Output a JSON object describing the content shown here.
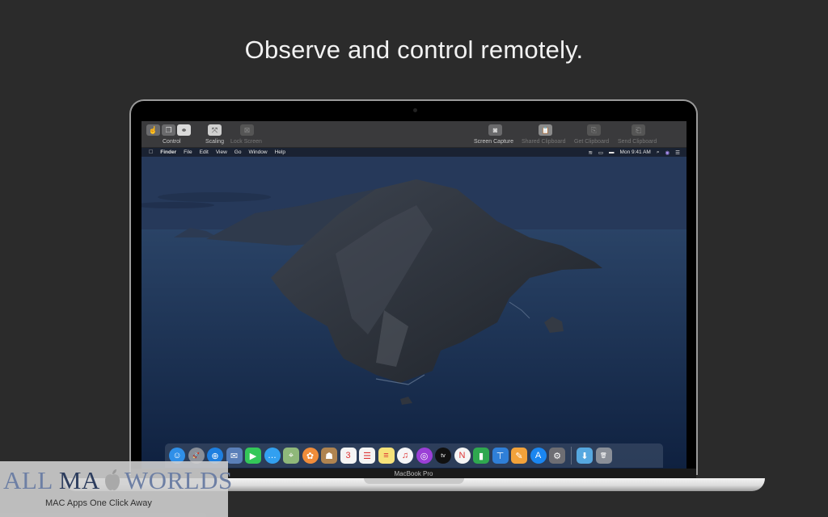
{
  "headline": "Observe and control remotely.",
  "device": {
    "model_label": "MacBook Pro"
  },
  "remote_toolbar": {
    "left_groups": [
      {
        "label": "Control",
        "buttons": [
          {
            "name": "pointer-control",
            "icon": "cursor-icon",
            "glyph": "☝",
            "state": "normal"
          },
          {
            "name": "window-control",
            "icon": "window-icon",
            "glyph": "❐",
            "state": "normal"
          },
          {
            "name": "observe",
            "icon": "binoculars-icon",
            "glyph": "⚭",
            "state": "active"
          }
        ]
      },
      {
        "label": "Scaling",
        "buttons": [
          {
            "name": "scaling",
            "icon": "scale-arrows-icon",
            "glyph": "⤧",
            "state": "normal"
          }
        ]
      },
      {
        "label": "Lock Screen",
        "buttons": [
          {
            "name": "lock-screen",
            "icon": "lock-screen-icon",
            "glyph": "⊠",
            "state": "disabled"
          }
        ]
      }
    ],
    "right_groups": [
      {
        "label": "Screen Capture",
        "icon": "camera-icon",
        "glyph": "◙",
        "state": "normal"
      },
      {
        "label": "Shared Clipboard",
        "icon": "shared-clipboard-icon",
        "glyph": "📋",
        "state": "disabled"
      },
      {
        "label": "Get Clipboard",
        "icon": "get-clipboard-icon",
        "glyph": "⎘",
        "state": "disabled"
      },
      {
        "label": "Send Clipboard",
        "icon": "send-clipboard-icon",
        "glyph": "⎗",
        "state": "disabled"
      }
    ]
  },
  "menubar": {
    "apple_glyph": "",
    "items": [
      "Finder",
      "File",
      "Edit",
      "View",
      "Go",
      "Window",
      "Help"
    ],
    "status": {
      "wifi_glyph": "≋",
      "airplay_glyph": "▭",
      "battery_glyph": "▬",
      "clock": "Mon 9:41 AM",
      "search_glyph": "⌕",
      "siri_glyph": "◉",
      "control_glyph": "☰"
    }
  },
  "dock": {
    "apps": [
      {
        "name": "Finder",
        "icon": "finder-icon",
        "glyph": "☺",
        "color": "#2f8fe8"
      },
      {
        "name": "Launchpad",
        "icon": "launchpad-icon",
        "glyph": "🚀",
        "color": "#8a8f98"
      },
      {
        "name": "Safari",
        "icon": "safari-icon",
        "glyph": "⊕",
        "color": "#1e7fe0"
      },
      {
        "name": "Mail",
        "icon": "mail-icon",
        "glyph": "✉",
        "color": "#5a7fb8"
      },
      {
        "name": "FaceTime",
        "icon": "facetime-icon",
        "glyph": "▶",
        "color": "#34c759"
      },
      {
        "name": "Messages",
        "icon": "messages-icon",
        "glyph": "…",
        "color": "#32a0f0"
      },
      {
        "name": "Maps",
        "icon": "maps-icon",
        "glyph": "⌖",
        "color": "#8fb87a"
      },
      {
        "name": "Photos",
        "icon": "photos-icon",
        "glyph": "✿",
        "color": "#f08c3a"
      },
      {
        "name": "Contacts",
        "icon": "contacts-icon",
        "glyph": "☗",
        "color": "#b08450"
      },
      {
        "name": "Calendar",
        "icon": "calendar-icon",
        "glyph": "3",
        "color": "#f4f4f4"
      },
      {
        "name": "Reminders",
        "icon": "reminders-icon",
        "glyph": "☰",
        "color": "#f4f4f4"
      },
      {
        "name": "Notes",
        "icon": "notes-icon",
        "glyph": "≡",
        "color": "#f6e27a"
      },
      {
        "name": "Music",
        "icon": "music-icon",
        "glyph": "♫",
        "color": "#f5f5f7"
      },
      {
        "name": "Podcasts",
        "icon": "podcasts-icon",
        "glyph": "◎",
        "color": "#9b3fd6"
      },
      {
        "name": "TV",
        "icon": "apple-tv-icon",
        "glyph": "tv",
        "color": "#111111"
      },
      {
        "name": "News",
        "icon": "news-icon",
        "glyph": "N",
        "color": "#f4f4f4"
      },
      {
        "name": "Numbers",
        "icon": "numbers-icon",
        "glyph": "▮",
        "color": "#2fa84f"
      },
      {
        "name": "Keynote",
        "icon": "keynote-icon",
        "glyph": "⊤",
        "color": "#2f7fd8"
      },
      {
        "name": "Pages",
        "icon": "pages-icon",
        "glyph": "✎",
        "color": "#f2a23a"
      },
      {
        "name": "App Store",
        "icon": "app-store-icon",
        "glyph": "A",
        "color": "#1a86f0"
      },
      {
        "name": "System Preferences",
        "icon": "system-preferences-icon",
        "glyph": "⚙",
        "color": "#6e6e73"
      }
    ],
    "extras": [
      {
        "name": "Downloads",
        "icon": "downloads-folder-icon",
        "glyph": "⬇",
        "color": "#56a8e0"
      },
      {
        "name": "Trash",
        "icon": "trash-icon",
        "glyph": "🗑",
        "color": "#8a8f98"
      }
    ]
  },
  "watermark": {
    "title_part1": "ALL MA",
    "title_part2": "WORLDS",
    "subtitle": "MAC Apps One Click Away"
  }
}
